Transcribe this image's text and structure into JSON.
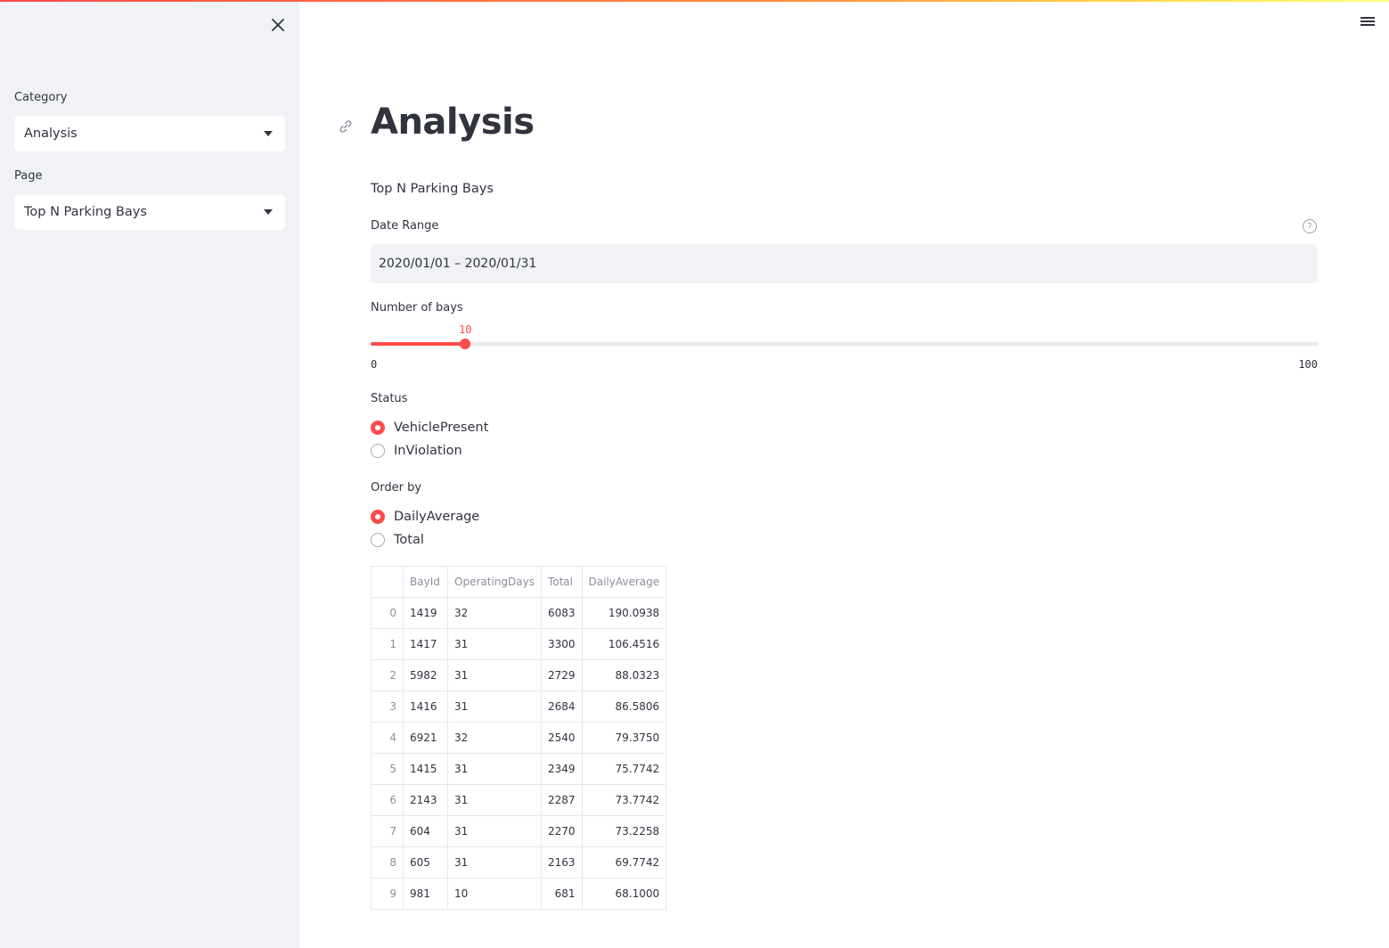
{
  "sidebar": {
    "category_label": "Category",
    "category_value": "Analysis",
    "page_label": "Page",
    "page_value": "Top N Parking Bays"
  },
  "main": {
    "title": "Analysis",
    "subtitle": "Top N Parking Bays",
    "date_range": {
      "label": "Date Range",
      "value": "2020/01/01 – 2020/01/31",
      "help": "?"
    },
    "slider": {
      "label": "Number of bays",
      "value": 10,
      "value_text": "10",
      "min_text": "0",
      "max_text": "100",
      "min": 0,
      "max": 100
    },
    "status": {
      "label": "Status",
      "options": [
        "VehiclePresent",
        "InViolation"
      ],
      "selected": "VehiclePresent"
    },
    "order_by": {
      "label": "Order by",
      "options": [
        "DailyAverage",
        "Total"
      ],
      "selected": "DailyAverage"
    },
    "table": {
      "columns": [
        "",
        "BayId",
        "OperatingDays",
        "Total",
        "DailyAverage"
      ],
      "rows": [
        [
          "0",
          "1419",
          "32",
          "6083",
          "190.0938"
        ],
        [
          "1",
          "1417",
          "31",
          "3300",
          "106.4516"
        ],
        [
          "2",
          "5982",
          "31",
          "2729",
          "88.0323"
        ],
        [
          "3",
          "1416",
          "31",
          "2684",
          "86.5806"
        ],
        [
          "4",
          "6921",
          "32",
          "2540",
          "79.3750"
        ],
        [
          "5",
          "1415",
          "31",
          "2349",
          "75.7742"
        ],
        [
          "6",
          "2143",
          "31",
          "2287",
          "73.7742"
        ],
        [
          "7",
          "604",
          "31",
          "2270",
          "73.2258"
        ],
        [
          "8",
          "605",
          "31",
          "2163",
          "69.7742"
        ],
        [
          "9",
          "981",
          "10",
          "681",
          "68.1000"
        ]
      ]
    }
  },
  "colors": {
    "accent": "#ff4b4b",
    "sidebar_bg": "#f0f2f6",
    "text": "#31333f"
  }
}
